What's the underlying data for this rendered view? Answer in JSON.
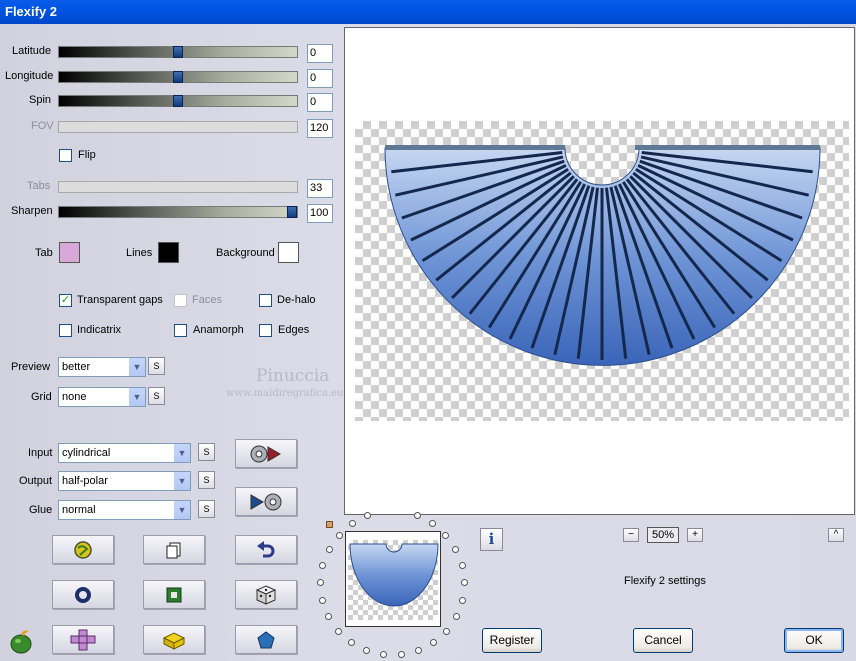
{
  "window": {
    "title": "Flexify 2"
  },
  "sliders": [
    {
      "label": "Latitude",
      "value": "0",
      "level": 0.5,
      "enabled": true
    },
    {
      "label": "Longitude",
      "value": "0",
      "level": 0.5,
      "enabled": true
    },
    {
      "label": "Spin",
      "value": "0",
      "level": 0.5,
      "enabled": true
    },
    {
      "label": "FOV",
      "value": "120",
      "level": null,
      "enabled": false
    },
    {
      "label": "Tabs",
      "value": "33",
      "level": null,
      "enabled": false
    },
    {
      "label": "Sharpen",
      "value": "100",
      "level": 1.0,
      "enabled": true
    }
  ],
  "flip": {
    "label": "Flip",
    "checked": false
  },
  "colors": {
    "tab": {
      "label": "Tab",
      "value": "#d8a8d8"
    },
    "lines": {
      "label": "Lines",
      "value": "#000000"
    },
    "background": {
      "label": "Background",
      "value": "#ffffff"
    }
  },
  "options": {
    "transparent_gaps": {
      "label": "Transparent gaps",
      "checked": true
    },
    "faces": {
      "label": "Faces",
      "checked": false,
      "enabled": false
    },
    "de_halo": {
      "label": "De-halo",
      "checked": false
    },
    "indicatrix": {
      "label": "Indicatrix",
      "checked": false
    },
    "anamorph": {
      "label": "Anamorph",
      "checked": false
    },
    "edges": {
      "label": "Edges",
      "checked": false
    }
  },
  "preview_select": {
    "label": "Preview",
    "value": "better"
  },
  "grid_select": {
    "label": "Grid",
    "value": "none"
  },
  "input_select": {
    "label": "Input",
    "value": "cylindrical"
  },
  "output_select": {
    "label": "Output",
    "value": "half-polar"
  },
  "glue_select": {
    "label": "Glue",
    "value": "normal"
  },
  "small_button_label": "S",
  "watermark": {
    "name": "Pinuccia",
    "site": "www.maidiregrafica.eu"
  },
  "zoom": {
    "minus": "−",
    "value": "50%",
    "plus": "+"
  },
  "expand_label": "^",
  "settings_label": "Flexify 2 settings",
  "info_label": "i",
  "buttons": {
    "register": "Register",
    "cancel": "Cancel",
    "ok": "OK"
  }
}
